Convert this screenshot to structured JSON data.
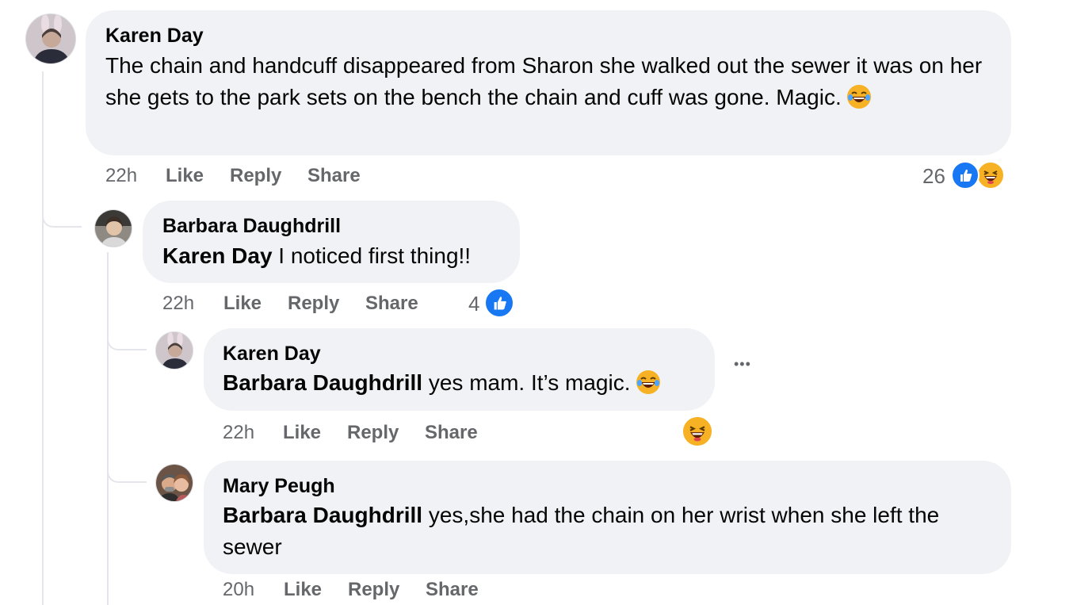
{
  "comments": [
    {
      "author": "Karen Day",
      "text": "The chain and handcuff disappeared from Sharon she walked out the sewer it was on her she gets to the park sets on the bench the chain and cuff was gone. Magic.",
      "emoji": "laughing-tears",
      "time": "22h",
      "like": "Like",
      "reply": "Reply",
      "share": "Share",
      "reaction_count": "26",
      "reactions": [
        "like",
        "haha"
      ]
    },
    {
      "author": "Barbara Daughdrill",
      "mention": "Karen Day",
      "text": " I noticed first thing!!",
      "time": "22h",
      "like": "Like",
      "reply": "Reply",
      "share": "Share",
      "reaction_count": "4",
      "reactions": [
        "like"
      ]
    },
    {
      "author": "Karen Day",
      "mention": "Barbara Daughdrill",
      "text": " yes mam. It’s magic.",
      "emoji": "laughing-tears",
      "time": "22h",
      "like": "Like",
      "reply": "Reply",
      "share": "Share",
      "reactions": [
        "haha"
      ],
      "more_label": "•••"
    },
    {
      "author": "Mary Peugh",
      "mention": "Barbara Daughdrill",
      "text": " yes,she had the chain on her wrist when she left the sewer",
      "time": "20h",
      "like": "Like",
      "reply": "Reply",
      "share": "Share"
    }
  ],
  "colors": {
    "bubble": "#f0f2f5",
    "meta": "#65676b",
    "like_blue": "#1877f2",
    "haha_yellow": "#f7b125"
  }
}
